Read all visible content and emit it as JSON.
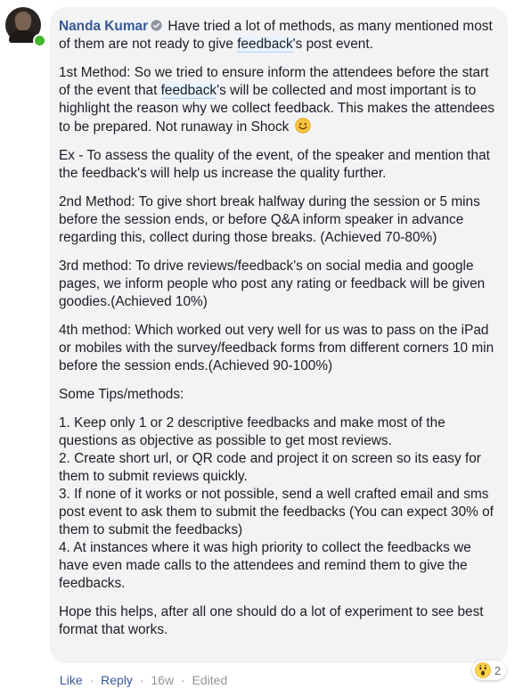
{
  "comment": {
    "author": "Nanda Kumar",
    "intro_before_tag": "Have tried a lot of methods, as many mentioned most of them are not ready to give ",
    "intro_tag": "feedback",
    "intro_after_tag": "'s post event.",
    "method1_before_tag": "1st Method: So we tried to ensure inform the attendees before the start of the event that ",
    "method1_tag": "feedback",
    "method1_after_tag": "'s will be collected and most important is to highlight the reason why we collect feedback. This makes the attendees to be prepared. Not runaway in Shock",
    "example": "Ex - To assess the quality of the event, of the speaker and mention that the feedback's will help us increase the quality further.",
    "method2": "2nd Method: To give short break halfway during the session or 5 mins before the session ends, or before Q&A inform speaker in advance regarding this, collect during those breaks. (Achieved 70-80%)",
    "method3": "3rd method: To drive reviews/feedback's on social media and google pages, we inform people who post any rating or feedback will be given goodies.(Achieved 10%)",
    "method4": "4th method: Which worked out very well for us was to pass on the iPad or mobiles with the survey/feedback forms from different corners 10 min before the session ends.(Achieved 90-100%)",
    "tips_heading": "Some Tips/methods:",
    "tips": [
      "1. Keep only 1 or 2 descriptive feedbacks and make most of the questions as objective as possible to get most reviews.",
      "2. Create short url, or QR code and project it on screen so its easy for them to submit reviews quickly.",
      "3. If none of it works or not possible, send a well crafted email and sms post event to ask them to submit the feedbacks (You can expect 30% of them to submit the feedbacks)",
      "4. At instances where it was high priority to collect the feedbacks we have even made calls to the attendees and remind them to give the feedbacks."
    ],
    "closing": "Hope this helps, after all one should do a lot of experiment to see best format that works."
  },
  "reactions": {
    "icon": "wow-emoji-icon",
    "count": "2"
  },
  "actions": {
    "like": "Like",
    "reply": "Reply",
    "age": "16w",
    "edited": "Edited",
    "separator": "·"
  },
  "colors": {
    "author": "#385898",
    "bubble": "#f2f3f5",
    "online": "#42b72a",
    "meta": "#90949c"
  }
}
